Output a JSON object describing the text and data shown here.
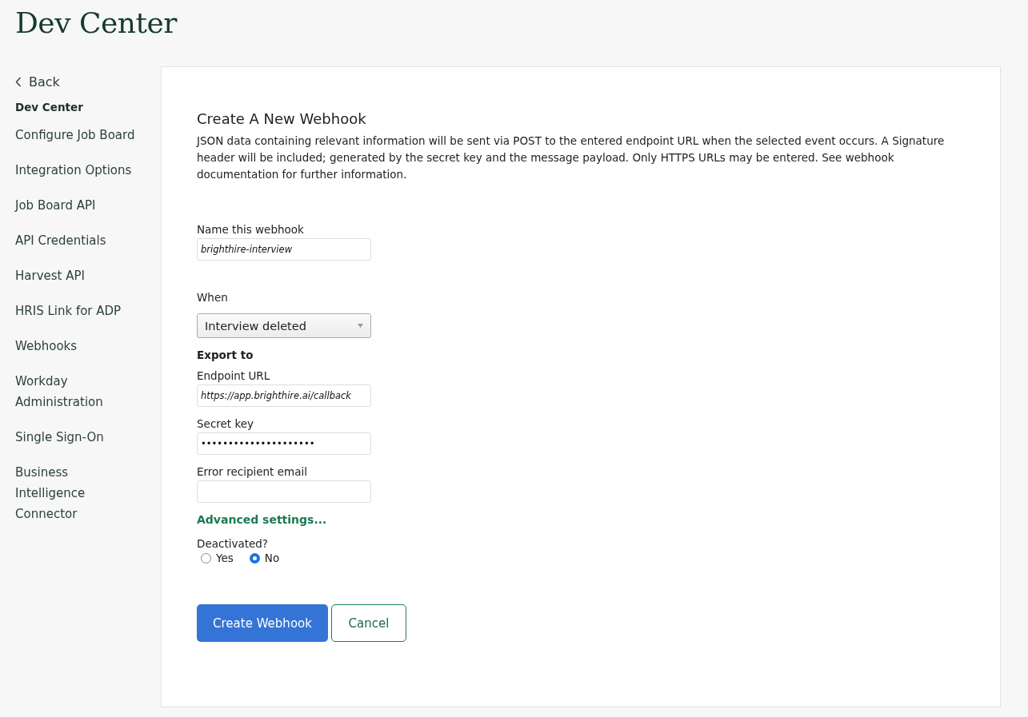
{
  "page_title": "Dev Center",
  "sidebar": {
    "back": "Back",
    "items": [
      {
        "kind": "heading",
        "label": "Dev Center"
      },
      {
        "kind": "link",
        "label": "Configure Job Board"
      },
      {
        "kind": "link",
        "label": "Integration Options"
      },
      {
        "kind": "link",
        "label": "Job Board API"
      },
      {
        "kind": "link",
        "label": "API Credentials"
      },
      {
        "kind": "link",
        "label": "Harvest API"
      },
      {
        "kind": "link",
        "label": "HRIS Link for ADP"
      },
      {
        "kind": "link",
        "label": "Webhooks"
      },
      {
        "kind": "link",
        "label": "Workday Administration"
      },
      {
        "kind": "link",
        "label": "Single Sign-On"
      },
      {
        "kind": "link",
        "label": "Business Intelligence Connector"
      }
    ]
  },
  "form": {
    "title": "Create A New Webhook",
    "description": "JSON data containing relevant information will be sent via POST to the entered endpoint URL when the selected event occurs. A Signature header will be included; generated by the secret key and the message payload. Only HTTPS URLs may be entered. See webhook documentation for further information.",
    "fields": [
      {
        "kind": "text",
        "label": "Name this webhook",
        "value": "brighthire-interview"
      },
      {
        "kind": "select",
        "label": "When",
        "value": "Interview deleted"
      },
      {
        "kind": "section",
        "label": "Export to"
      },
      {
        "kind": "text",
        "label": "Endpoint URL",
        "value": "https://app.brighthire.ai/callback"
      },
      {
        "kind": "text",
        "label": "Secret key",
        "value": "•••••••••••••••••••••"
      },
      {
        "kind": "text",
        "label": "Error recipient email"
      }
    ],
    "advanced_link": "Advanced settings...",
    "deactivated": {
      "label": "Deactivated?",
      "options": [
        {
          "label": "Yes",
          "selected": false
        },
        {
          "label": "No",
          "selected": true
        }
      ]
    },
    "buttons": [
      {
        "kind": "primary",
        "label": "Create Webhook"
      },
      {
        "kind": "secondary",
        "label": "Cancel"
      }
    ]
  }
}
